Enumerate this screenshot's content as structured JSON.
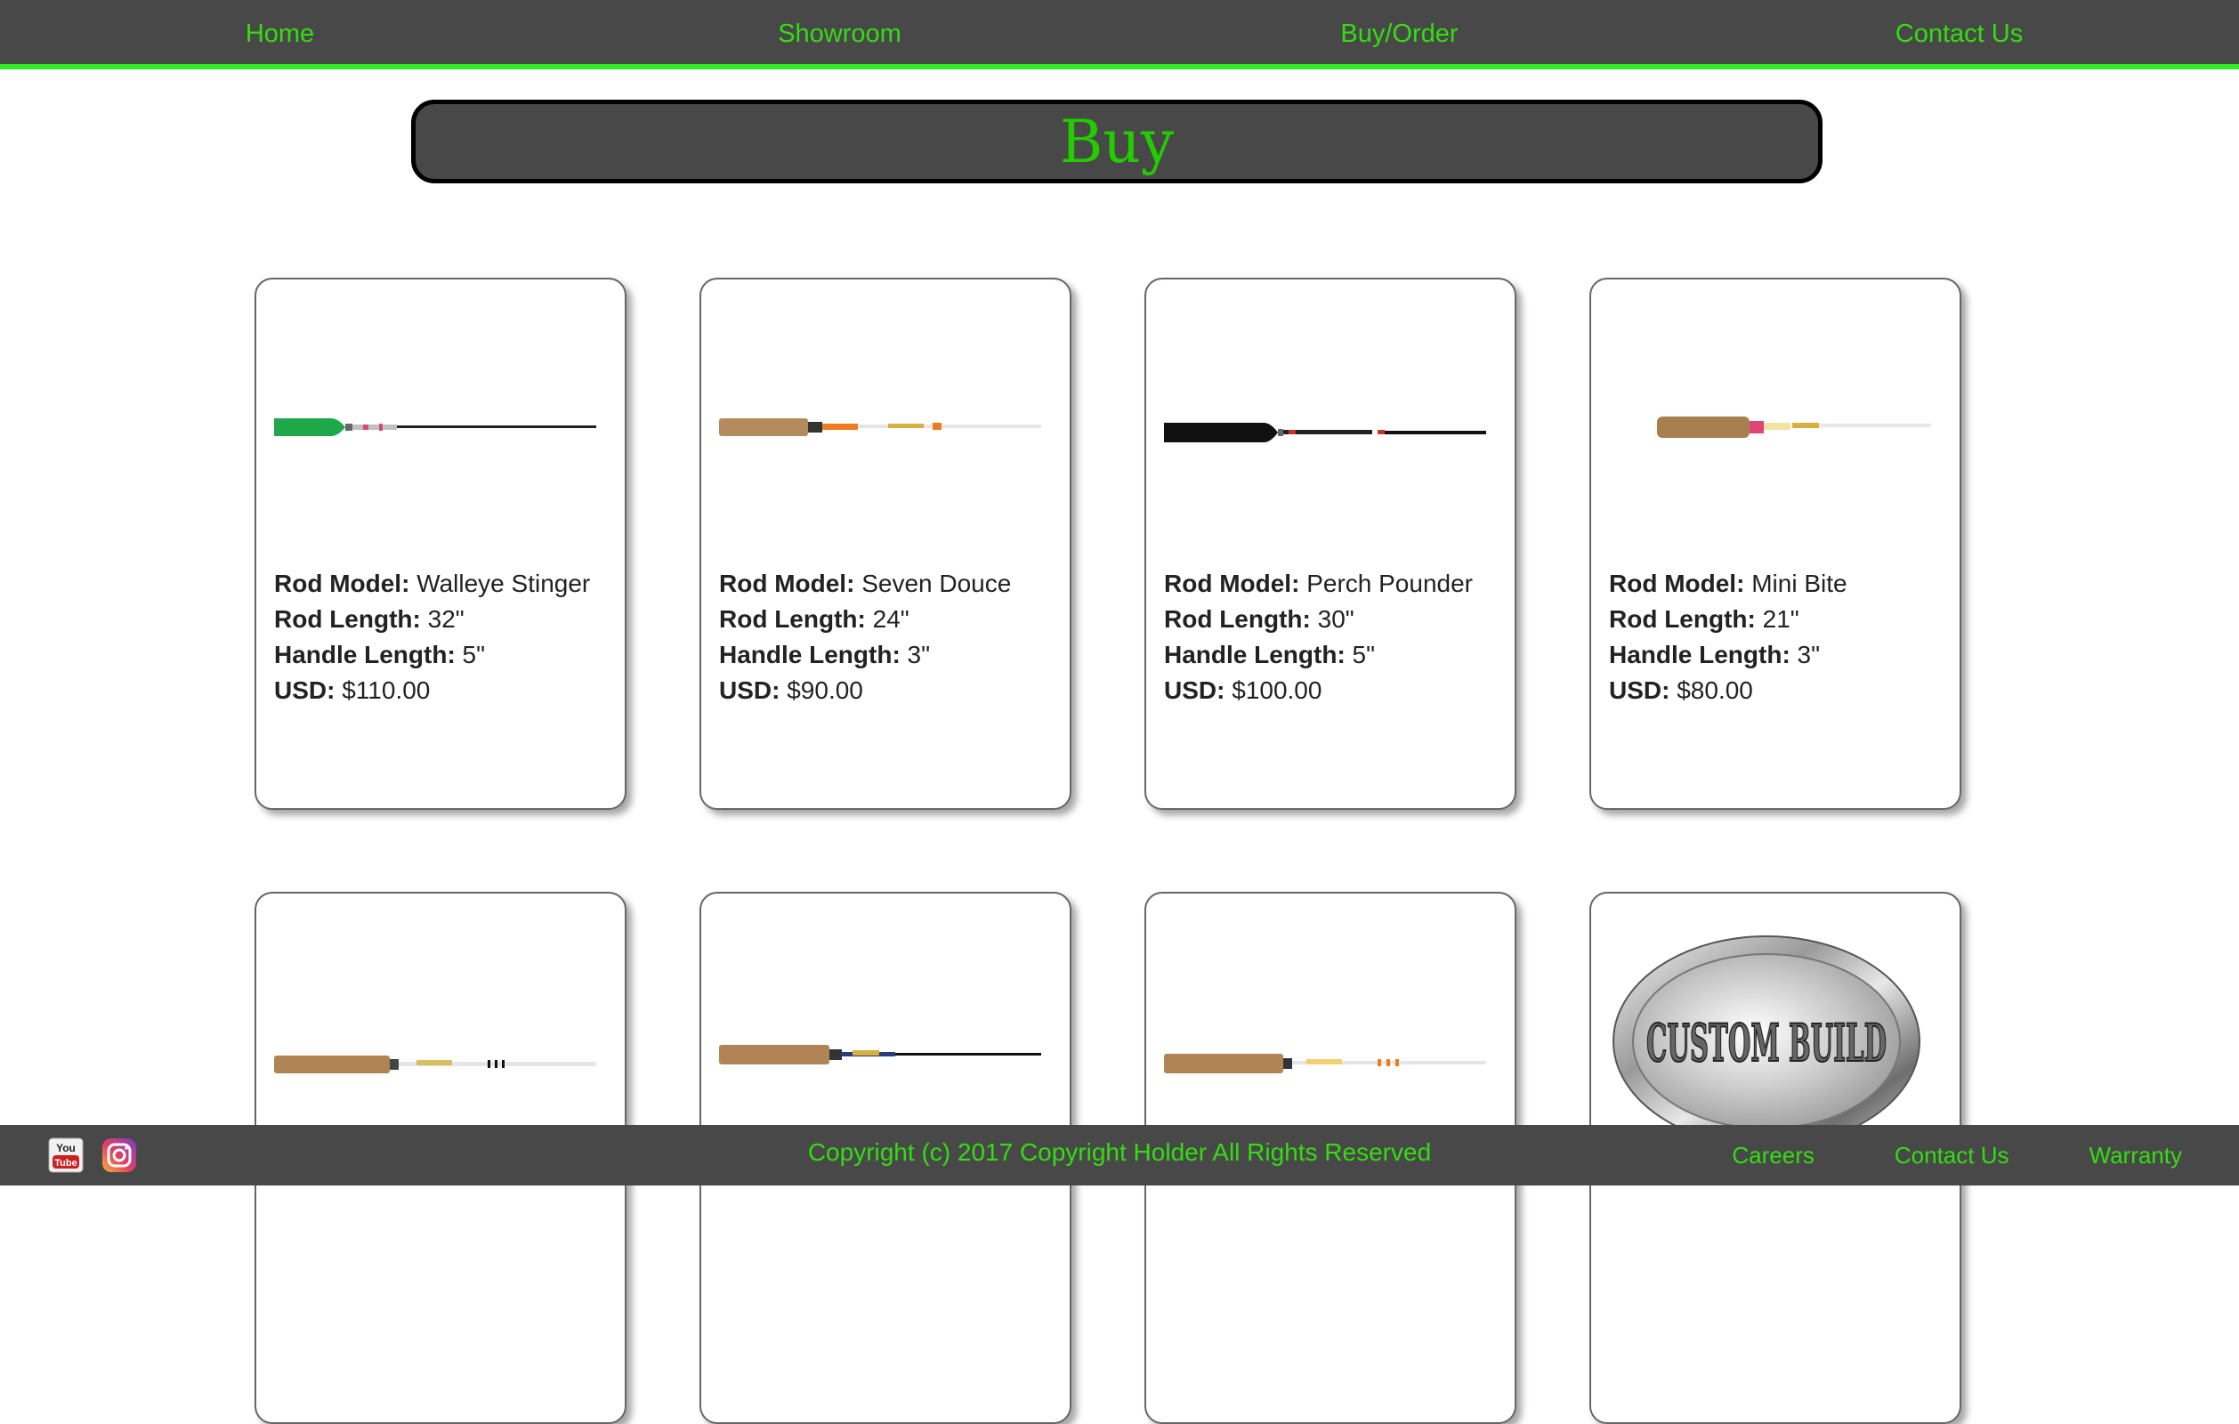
{
  "nav": {
    "items": [
      {
        "label": "Home"
      },
      {
        "label": "Showroom"
      },
      {
        "label": "Buy/Order"
      },
      {
        "label": "Contact Us"
      }
    ]
  },
  "page": {
    "title": "Buy"
  },
  "labels": {
    "model": "Rod Model:",
    "length": "Rod Length:",
    "handle": "Handle Length:",
    "usd": "USD:"
  },
  "products": [
    {
      "model": "Walleye Stinger",
      "length": "32\"",
      "handle": "5\"",
      "price": "$110.00",
      "icon": "green-handle-rod-image"
    },
    {
      "model": "Seven Douce",
      "length": "24\"",
      "handle": "3\"",
      "price": "$90.00",
      "icon": "cork-handle-rod-image"
    },
    {
      "model": "Perch Pounder",
      "length": "30\"",
      "handle": "5\"",
      "price": "$100.00",
      "icon": "black-handle-rod-image"
    },
    {
      "model": "Mini Bite",
      "length": "21\"",
      "handle": "3\"",
      "price": "$80.00",
      "icon": "short-cork-rod-image"
    },
    {
      "icon": "cork-handle-rod-image"
    },
    {
      "icon": "cork-handle-rod-image"
    },
    {
      "icon": "cork-handle-rod-image"
    },
    {
      "icon": "custom-build-badge-image",
      "badge_text": "CUSTOM BUILD"
    }
  ],
  "footer": {
    "copyright": "Copyright (c) 2017 Copyright Holder All Rights Reserved",
    "social": [
      {
        "icon": "youtube-icon",
        "text_top": "You",
        "text_bottom": "Tube"
      },
      {
        "icon": "instagram-icon"
      }
    ],
    "links": [
      {
        "label": "Careers"
      },
      {
        "label": "Contact Us"
      },
      {
        "label": "Warranty"
      }
    ]
  },
  "colors": {
    "bar_bg": "#484848",
    "accent_green": "#33dd11",
    "title_green": "#22cc00"
  }
}
